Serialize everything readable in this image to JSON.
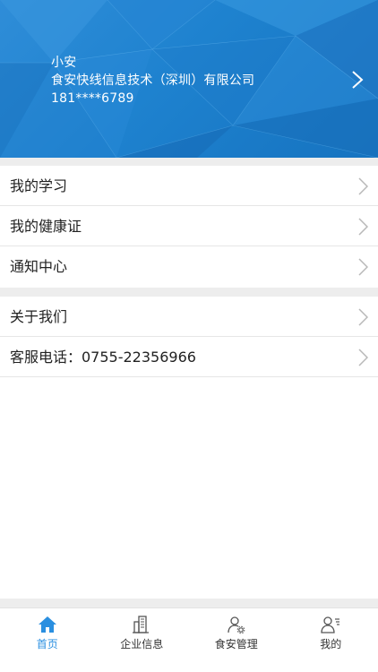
{
  "profile": {
    "name": "小安",
    "company": "食安快线信息技术（深圳）有限公司",
    "phone": "181****6789"
  },
  "menu_group_1": [
    {
      "label": "我的学习"
    },
    {
      "label": "我的健康证"
    },
    {
      "label": "通知中心"
    }
  ],
  "menu_group_2": [
    {
      "label": "关于我们"
    },
    {
      "label": "客服电话：0755-22356966"
    }
  ],
  "tabbar": {
    "items": [
      {
        "label": "首页",
        "icon": "home-icon",
        "active": true
      },
      {
        "label": "企业信息",
        "icon": "building-icon",
        "active": false
      },
      {
        "label": "食安管理",
        "icon": "user-gear-icon",
        "active": false
      },
      {
        "label": "我的",
        "icon": "user-list-icon",
        "active": false
      }
    ]
  },
  "colors": {
    "header_blue": "#1e82cf",
    "active_tab": "#2a8fe0",
    "separator": "#ededed"
  }
}
